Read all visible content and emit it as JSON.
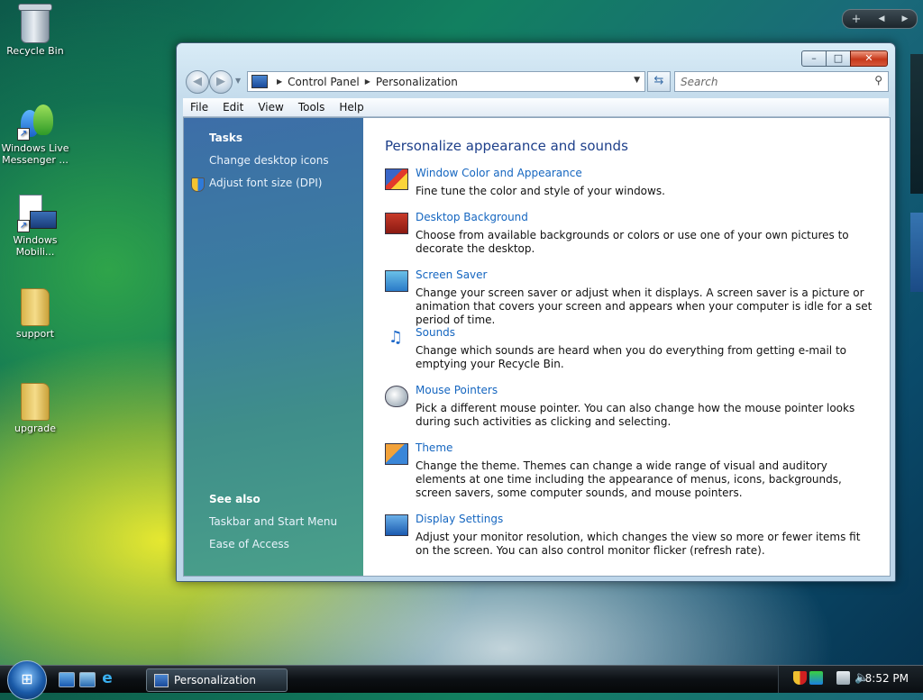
{
  "desktop": {
    "icons": [
      {
        "label": "Recycle Bin"
      },
      {
        "label": "Windows Live Messenger ..."
      },
      {
        "label": "Windows Mobili..."
      },
      {
        "label": "support"
      },
      {
        "label": "upgrade"
      }
    ]
  },
  "window": {
    "caption": {
      "minimize": "–",
      "maximize": "□",
      "close": "✕"
    },
    "nav": {
      "back": "◀",
      "forward": "▶",
      "dropdown": "▼"
    },
    "breadcrumb": [
      "Control Panel",
      "Personalization"
    ],
    "search": {
      "placeholder": "Search"
    },
    "menu": [
      "File",
      "Edit",
      "View",
      "Tools",
      "Help"
    ],
    "tasks": {
      "heading": "Tasks",
      "links": [
        "Change desktop icons",
        "Adjust font size (DPI)"
      ]
    },
    "see_also": {
      "heading": "See also",
      "links": [
        "Taskbar and Start Menu",
        "Ease of Access"
      ]
    },
    "main_title": "Personalize appearance and sounds",
    "items": [
      {
        "title": "Window Color and Appearance",
        "desc": "Fine tune the color and style of your windows.",
        "icon": "window-color-icon"
      },
      {
        "title": "Desktop Background",
        "desc": "Choose from available backgrounds or colors or use one of your own pictures to decorate the desktop.",
        "icon": "desktop-background-icon"
      },
      {
        "title": "Screen Saver",
        "desc": "Change your screen saver or adjust when it displays. A screen saver is a picture or animation that covers your screen and appears when your computer is idle for a set period of time.",
        "icon": "screen-saver-icon"
      },
      {
        "title": "Sounds",
        "desc": "Change which sounds are heard when you do everything from getting e-mail to emptying your Recycle Bin.",
        "icon": "sounds-icon"
      },
      {
        "title": "Mouse Pointers",
        "desc": "Pick a different mouse pointer. You can also change how the mouse pointer looks during such activities as clicking and selecting.",
        "icon": "mouse-icon"
      },
      {
        "title": "Theme",
        "desc": "Change the theme. Themes can change a wide range of visual and auditory elements at one time including the appearance of menus, icons, backgrounds, screen savers, some computer sounds, and mouse pointers.",
        "icon": "theme-icon"
      },
      {
        "title": "Display Settings",
        "desc": "Adjust your monitor resolution, which changes the view so more or fewer items fit on the screen. You can also control monitor flicker (refresh rate).",
        "icon": "display-settings-icon"
      }
    ]
  },
  "taskbar": {
    "task_button": "Personalization",
    "clock": "8:52 PM"
  },
  "gadgets": {
    "add": "+",
    "prev": "◀",
    "next": "▶"
  },
  "colors": {
    "link": "#1566c0",
    "title": "#1d3f8a",
    "left_pane": "#3d6ea8"
  }
}
